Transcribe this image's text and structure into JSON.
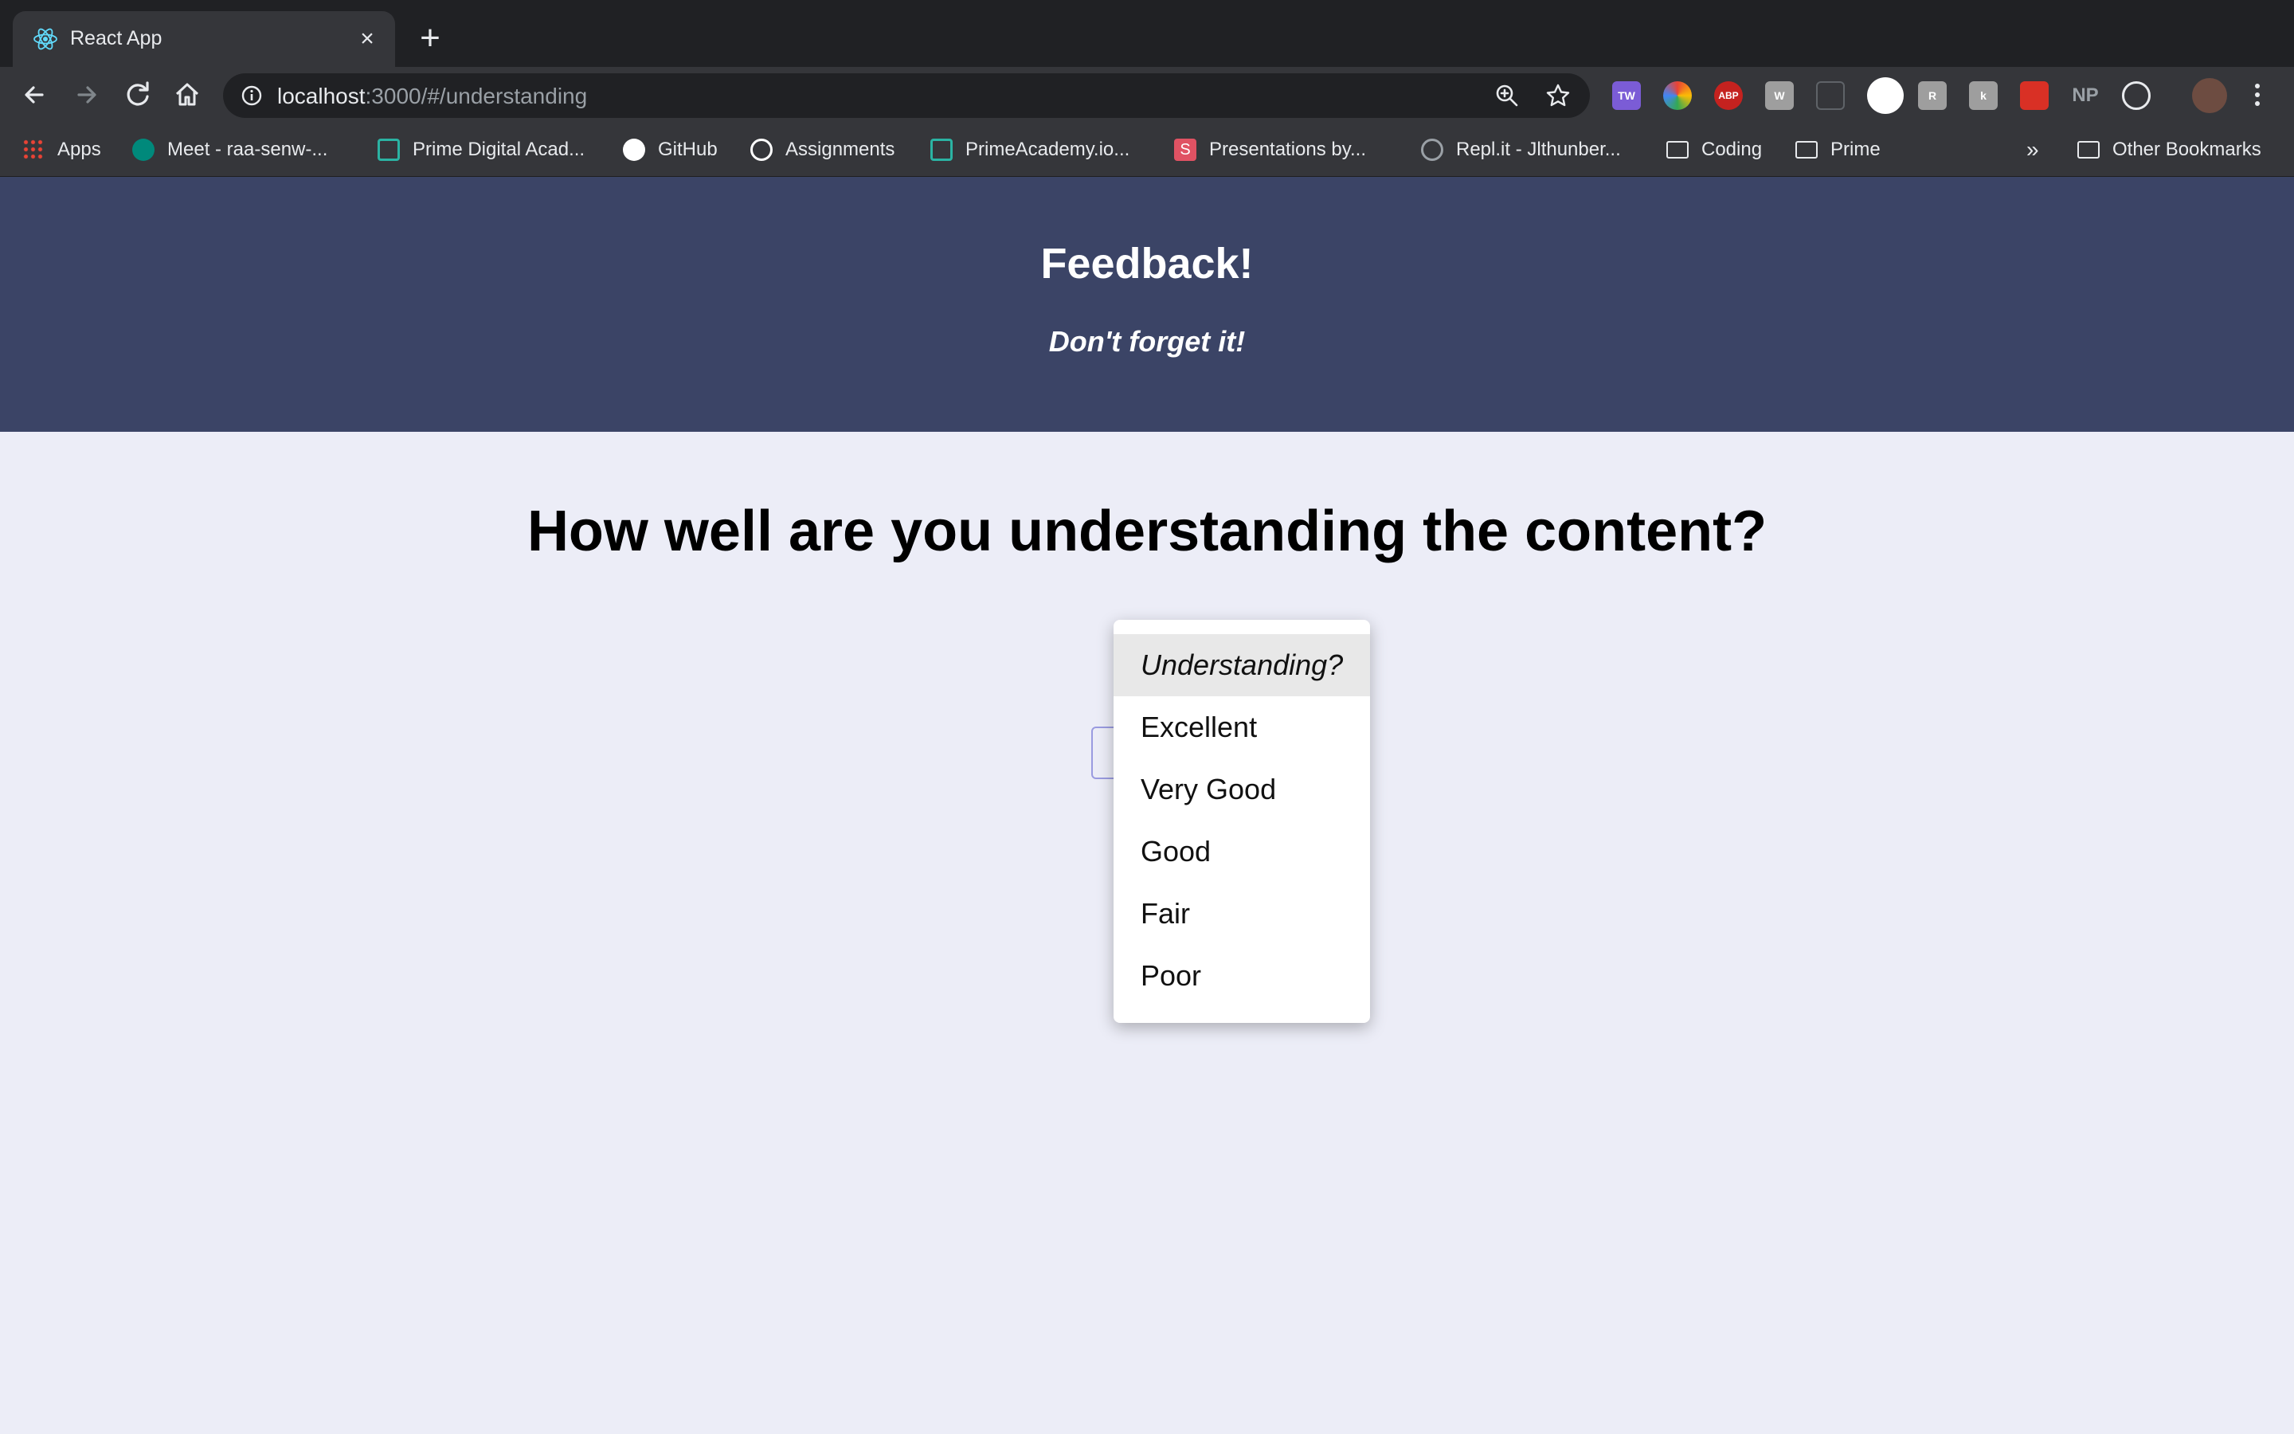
{
  "browser": {
    "tab_title": "React App",
    "url_host": "localhost",
    "url_path": ":3000/#/understanding",
    "bookmarks": [
      {
        "label": "Apps",
        "icon": "apps-grid-icon",
        "color": "#ea4335"
      },
      {
        "label": "Meet - raa-senw-...",
        "icon": "google-meet-icon",
        "color": "#00897b"
      },
      {
        "label": "Prime Digital Acad...",
        "icon": "prime-logo-icon",
        "color": "#2bb3a3"
      },
      {
        "label": "GitHub",
        "icon": "github-icon",
        "color": "#ffffff"
      },
      {
        "label": "Assignments",
        "icon": "globe-icon",
        "color": "#ffffff"
      },
      {
        "label": "PrimeAcademy.io...",
        "icon": "prime-logo-icon",
        "color": "#2bb3a3"
      },
      {
        "label": "Presentations by...",
        "icon": "slides-s-icon",
        "color": "#e05263"
      },
      {
        "label": "Repl.it - Jlthunber...",
        "icon": "replit-icon",
        "color": "#9aa0a6"
      },
      {
        "label": "Coding",
        "icon": "folder-icon",
        "color": "#e8eaed"
      },
      {
        "label": "Prime",
        "icon": "folder-icon",
        "color": "#e8eaed"
      }
    ],
    "bookmarks_overflow": "»",
    "other_bookmarks": "Other Bookmarks"
  },
  "header": {
    "title": "Feedback!",
    "subtitle": "Don't forget it!"
  },
  "main": {
    "question": "How well are you understanding the content?",
    "select": {
      "placeholder": "Understanding?",
      "options": [
        "Excellent",
        "Very Good",
        "Good",
        "Fair",
        "Poor"
      ]
    }
  },
  "colors": {
    "header_bg": "#3b4466",
    "page_bg": "#ecedf7",
    "select_border": "#9a9be0"
  }
}
